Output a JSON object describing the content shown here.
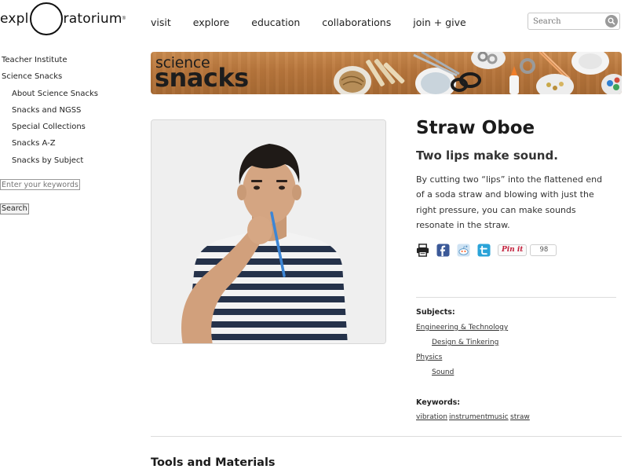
{
  "header": {
    "logo_left": "expl",
    "logo_right": "ratorium",
    "logo_mark": "®",
    "nav": [
      "visit",
      "explore",
      "education",
      "collaborations",
      "join + give"
    ],
    "search_placeholder": "Search"
  },
  "sidebar": {
    "items": [
      {
        "label": "Teacher Institute",
        "level": 1
      },
      {
        "label": "Science Snacks",
        "level": 1
      },
      {
        "label": "About Science Snacks",
        "level": 2
      },
      {
        "label": "Snacks and NGSS",
        "level": 2
      },
      {
        "label": "Special Collections",
        "level": 2
      },
      {
        "label": "Snacks A-Z",
        "level": 2
      },
      {
        "label": "Snacks by Subject",
        "level": 2
      }
    ],
    "keyword_placeholder": "Enter your keywords",
    "search_button": "Search"
  },
  "banner": {
    "line1": "science",
    "line2": "snacks"
  },
  "snack": {
    "title": "Straw Oboe",
    "subtitle": "Two lips make sound.",
    "description": "By cutting two “lips” into the flattened end of a soda straw and blowing with just the right pressure, you can make sounds resonate in the straw.",
    "share": {
      "icons": [
        "print-icon",
        "facebook-icon",
        "reddit-icon",
        "twitter-icon"
      ],
      "pin_label": "Pin it",
      "pin_count": "98"
    },
    "subjects_heading": "Subjects:",
    "subjects": [
      {
        "label": "Engineering & Technology",
        "level": 1
      },
      {
        "label": "Design & Tinkering",
        "level": 2
      },
      {
        "label": "Physics",
        "level": 1
      },
      {
        "label": "Sound",
        "level": 2
      }
    ],
    "keywords_heading": "Keywords:",
    "keywords": [
      "vibration",
      "instrument",
      "music",
      "straw"
    ]
  },
  "section": {
    "tools_heading": "Tools and Materials"
  },
  "colors": {
    "banner_wood": "#b8763c",
    "pinterest_red": "#c41e3a",
    "facebook_blue": "#3b5998",
    "twitter_blue": "#2aa3d8",
    "straw_blue": "#3d86d6"
  }
}
